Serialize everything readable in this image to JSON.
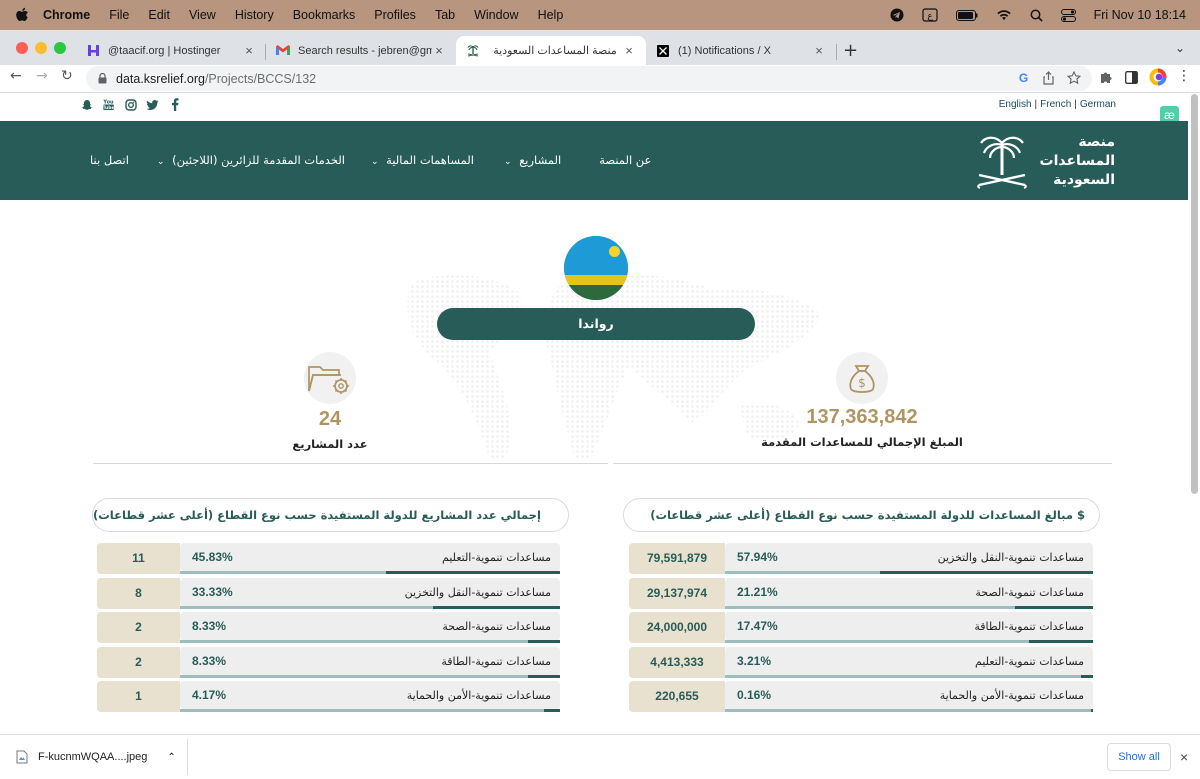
{
  "menubar": {
    "items": [
      "Chrome",
      "File",
      "Edit",
      "View",
      "History",
      "Bookmarks",
      "Profiles",
      "Tab",
      "Window",
      "Help"
    ],
    "datetime": "Fri Nov 10  18:14"
  },
  "tabs": [
    {
      "title": "@taacif.org | Hostinger"
    },
    {
      "title": "Search results - jebren@gmail..."
    },
    {
      "title": "منصة المساعدات السعودية"
    },
    {
      "title": "(1) Notifications / X"
    }
  ],
  "toolbar": {
    "url_host": "data.ksrelief.org",
    "url_path": "/Projects/BCCS/132"
  },
  "site": {
    "languages": [
      "English",
      "French",
      "German"
    ],
    "nav": [
      "عن المنصة",
      "المشاريع",
      "المساهمات المالية",
      "الخدمات المقدمة للزائرين (اللاجئين)",
      "اتصل بنا"
    ],
    "logo_line1": "منصة",
    "logo_line2": "المساعدات",
    "logo_line3": "السعودية",
    "ae_icon": "æ"
  },
  "country": {
    "name": "رواندا"
  },
  "stats": {
    "total_amount": "137,363,842",
    "total_amount_label": "المبلغ الإجمالي للمساعدات المقدمة",
    "projects_count": "24",
    "projects_label": "عدد المشاريع"
  },
  "amounts_panel": {
    "title": "مبالغ المساعدات للدولة المستفيدة حسب نوع القطاع (أعلى عشر قطاعات) $",
    "rows": [
      {
        "label": "مساعدات تنموية-النقل والتخزين",
        "pct": "57.94%",
        "value": "79,591,879",
        "fraction": 0.5794
      },
      {
        "label": "مساعدات تنموية-الصحة",
        "pct": "21.21%",
        "value": "29,137,974",
        "fraction": 0.2121
      },
      {
        "label": "مساعدات تنموية-الطاقة",
        "pct": "17.47%",
        "value": "24,000,000",
        "fraction": 0.1747
      },
      {
        "label": "مساعدات تنموية-التعليم",
        "pct": "3.21%",
        "value": "4,413,333",
        "fraction": 0.0321
      },
      {
        "label": "مساعدات تنموية-الأمن والحماية",
        "pct": "0.16%",
        "value": "220,655",
        "fraction": 0.0016
      }
    ]
  },
  "projects_panel": {
    "title": "إجمالي عدد المشاريع للدولة المستفيدة حسب نوع القطاع (أعلى عشر قطاعات)",
    "rows": [
      {
        "label": "مساعدات تنموية-التعليم",
        "pct": "45.83%",
        "value": "11",
        "fraction": 0.4583
      },
      {
        "label": "مساعدات تنموية-النقل والتخزين",
        "pct": "33.33%",
        "value": "8",
        "fraction": 0.3333
      },
      {
        "label": "مساعدات تنموية-الصحة",
        "pct": "8.33%",
        "value": "2",
        "fraction": 0.0833
      },
      {
        "label": "مساعدات تنموية-الطاقة",
        "pct": "8.33%",
        "value": "2",
        "fraction": 0.0833
      },
      {
        "label": "مساعدات تنموية-الأمن والحماية",
        "pct": "4.17%",
        "value": "1",
        "fraction": 0.0417
      }
    ]
  },
  "download": {
    "filename": "F-kucnmWQAA....jpeg",
    "show_all": "Show all"
  },
  "colors": {
    "brand": "#285c58",
    "gold": "#b09563"
  }
}
